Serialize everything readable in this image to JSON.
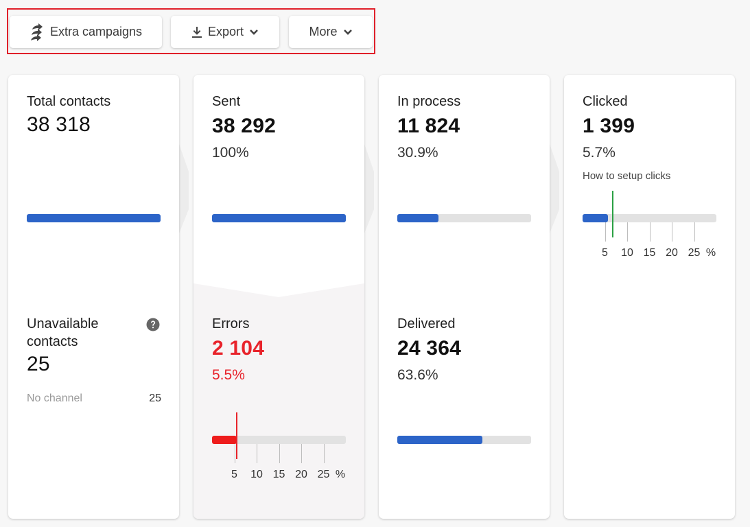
{
  "toolbar": {
    "extra_campaigns": {
      "label": "Extra campaigns",
      "icon": "triple-arrow-icon"
    },
    "export": {
      "label": "Export",
      "icon": "download-icon",
      "dropdown": true
    },
    "more": {
      "label": "More",
      "dropdown": true
    }
  },
  "colors": {
    "accent_blue": "#2c64c8",
    "error_red": "#e8232b",
    "benchmark_green": "#2aa043",
    "highlight_border": "#e0202a"
  },
  "scale": {
    "ticks": [
      "5",
      "10",
      "15",
      "20",
      "25"
    ],
    "unit": "%",
    "max_percent": 30
  },
  "cards": {
    "total": {
      "label": "Total contacts",
      "value": "38 318",
      "progress_percent": 100,
      "unavailable": {
        "label_line1": "Unavailable",
        "label_line2": "contacts",
        "value": "25",
        "help_icon": "question-circle-icon",
        "rows": [
          {
            "label": "No channel",
            "value": "25"
          }
        ]
      }
    },
    "sent": {
      "label": "Sent",
      "value": "38 292",
      "percent": "100%",
      "progress_percent": 100,
      "errors": {
        "label": "Errors",
        "value": "2 104",
        "percent": "5.5%",
        "progress_percent": 5.5,
        "marker_percent": 5.5
      }
    },
    "in_process": {
      "label": "In process",
      "value": "11 824",
      "percent": "30.9%",
      "progress_percent": 30.9,
      "delivered": {
        "label": "Delivered",
        "value": "24 364",
        "percent": "63.6%",
        "progress_percent": 63.6
      }
    },
    "clicked": {
      "label": "Clicked",
      "value": "1 399",
      "percent": "5.7%",
      "link": "How to setup clicks",
      "progress_percent": 5.7,
      "marker_percent": 6.8
    }
  }
}
